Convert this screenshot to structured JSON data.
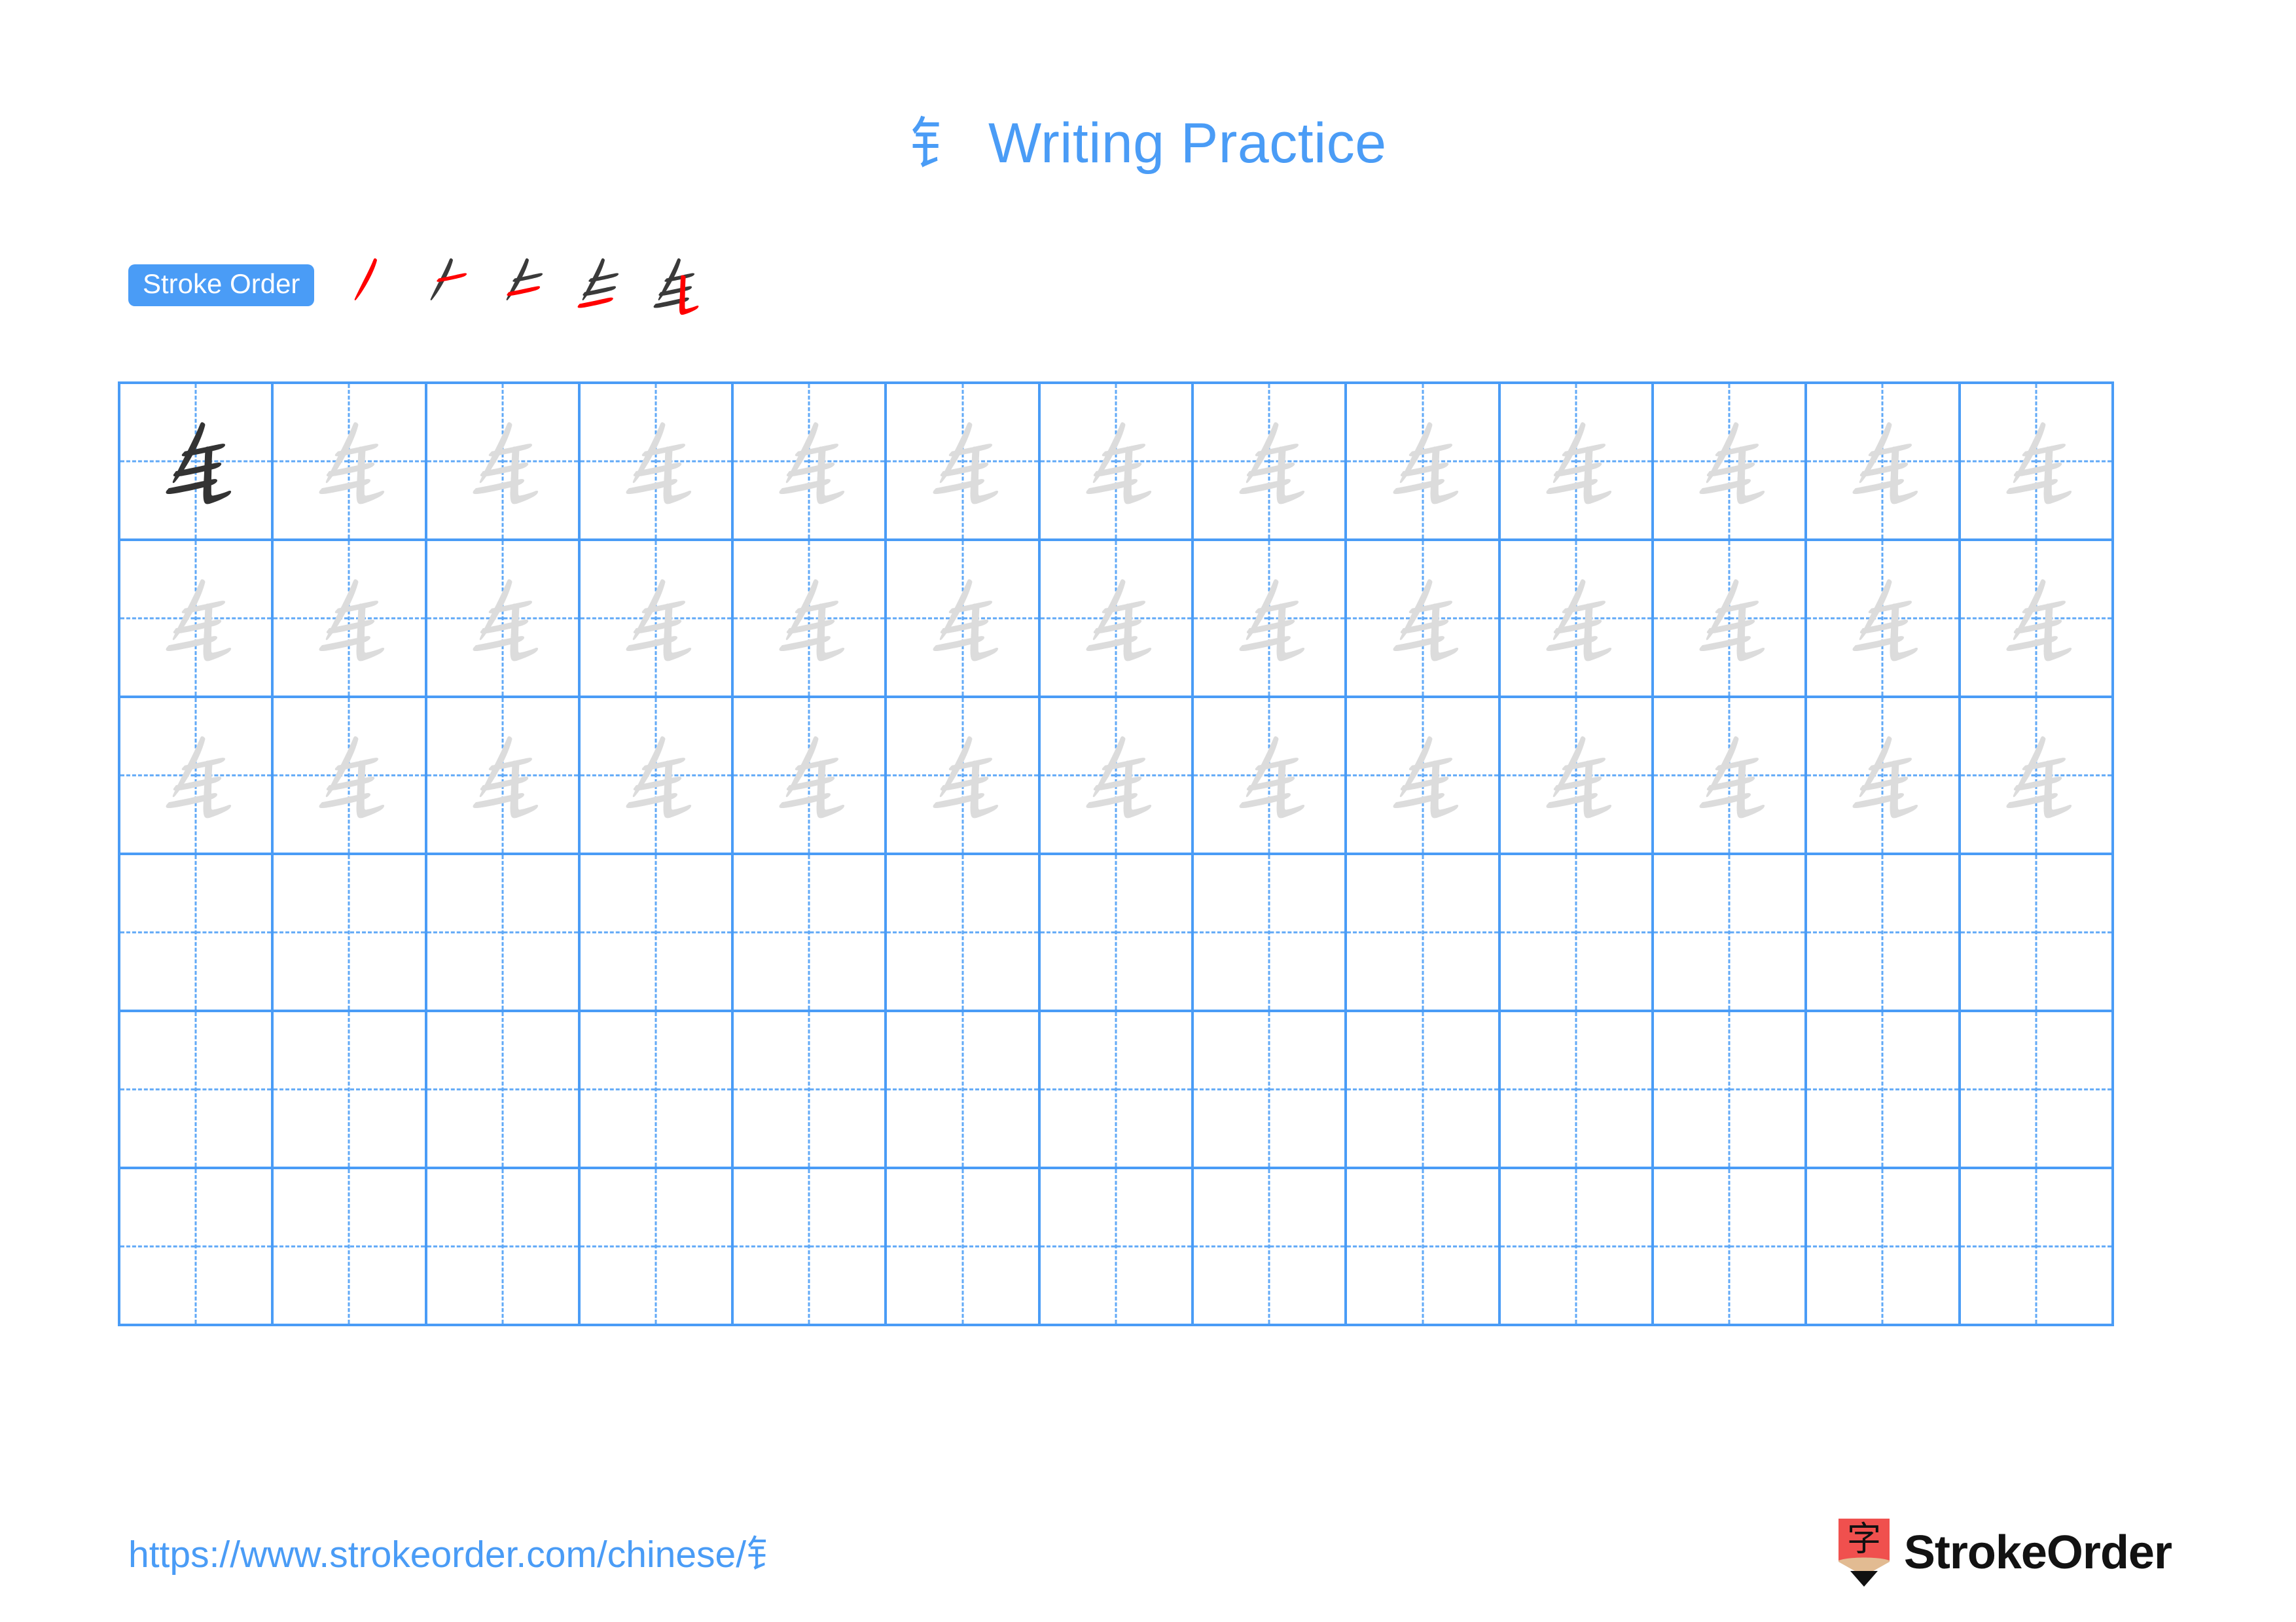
{
  "character": "钅",
  "title": {
    "character": "钅",
    "text": "Writing Practice"
  },
  "stroke_order": {
    "badge_label": "Stroke Order",
    "total_strokes": 5,
    "steps": [
      {
        "index": 1,
        "new_stroke": "piě (left-falling)"
      },
      {
        "index": 2,
        "new_stroke": "héng (horizontal)"
      },
      {
        "index": 3,
        "new_stroke": "héng (horizontal)"
      },
      {
        "index": 4,
        "new_stroke": "héng (horizontal)"
      },
      {
        "index": 5,
        "new_stroke": "shù-tí (vertical rising)"
      }
    ]
  },
  "grid": {
    "columns": 13,
    "rows": 6,
    "traced_rows": 3,
    "blank_rows": 3,
    "first_cell_style": "model",
    "model_color": "#333333",
    "trace_color": "#dcdcdc",
    "line_color": "#4a9cf6",
    "guide_color": "#60a9f7"
  },
  "footer": {
    "url": "https://www.strokeorder.com/chinese/钅",
    "brand_name": "StrokeOrder",
    "brand_mark_character": "字",
    "brand_mark_color": "#f0504e",
    "brand_wood_color": "#e2bb92"
  },
  "colors": {
    "accent": "#4a9cf6",
    "stroke_new": "#ff0000",
    "stroke_old": "#3a3a3a"
  }
}
